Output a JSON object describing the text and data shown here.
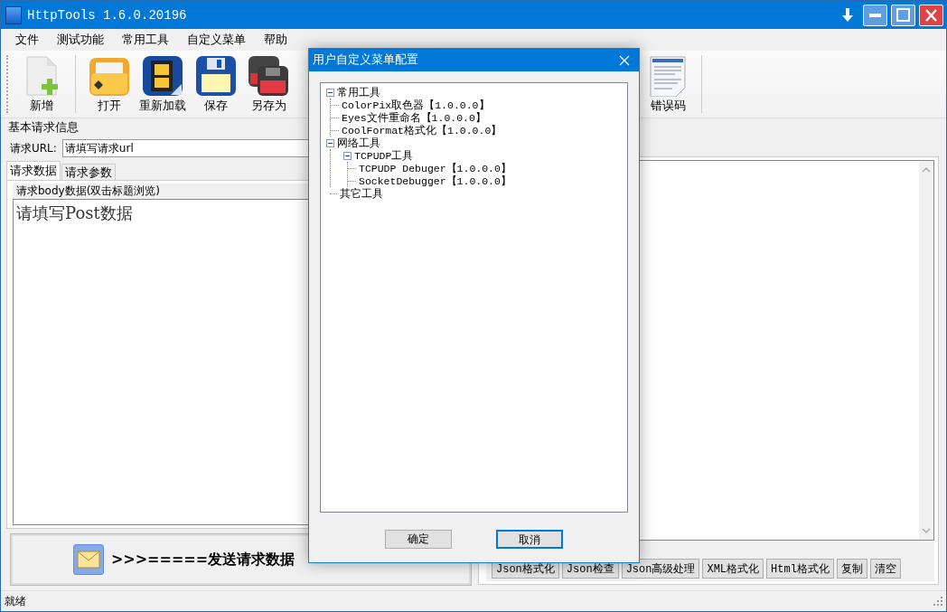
{
  "window": {
    "title": "HttpTools 1.6.0.20196"
  },
  "menu": [
    "文件",
    "测试功能",
    "常用工具",
    "自定义菜单",
    "帮助"
  ],
  "toolbar": [
    {
      "label": "新增",
      "kind": "new"
    },
    {
      "label": "打开",
      "kind": "open"
    },
    {
      "label": "重新加载",
      "kind": "reload"
    },
    {
      "label": "保存",
      "kind": "save"
    },
    {
      "label": "另存为",
      "kind": "saveas"
    },
    {
      "label": "错误码",
      "kind": "errors"
    }
  ],
  "request": {
    "group_title": "基本请求信息",
    "url_label": "请求URL:",
    "url_value": "请填写请求url",
    "tabs": [
      {
        "label": "请求数据",
        "selected": true
      },
      {
        "label": "请求参数",
        "selected": false
      }
    ],
    "body_title": "请求body数据(双击标题浏览)",
    "body_placeholder": "请填写Post数据",
    "send_button": {
      "label": ">>>=====发送请求数据"
    }
  },
  "response": {
    "buttons": [
      "Json格式化",
      "Json检查",
      "Json高级处理",
      "XML格式化",
      "Html格式化",
      "复制",
      "清空"
    ]
  },
  "status_bar": "就绪",
  "dialog": {
    "title": "用户自定义菜单配置",
    "tree": [
      {
        "label": "常用工具",
        "expanded": true,
        "children": [
          {
            "label": "ColorPix取色器【1.0.0.0】"
          },
          {
            "label": "Eyes文件重命名【1.0.0.0】"
          },
          {
            "label": "CoolFormat格式化【1.0.0.0】"
          }
        ]
      },
      {
        "label": "网络工具",
        "expanded": true,
        "children": [
          {
            "label": "TCPUDP工具",
            "expanded": true,
            "children": [
              {
                "label": "TCPUDP Debuger【1.0.0.0】"
              },
              {
                "label": "SocketDebugger【1.0.0.0】"
              }
            ]
          }
        ]
      },
      {
        "label": "其它工具"
      }
    ],
    "buttons": [
      {
        "label": "确定",
        "selected": false
      },
      {
        "label": "取消",
        "selected": true
      }
    ]
  }
}
